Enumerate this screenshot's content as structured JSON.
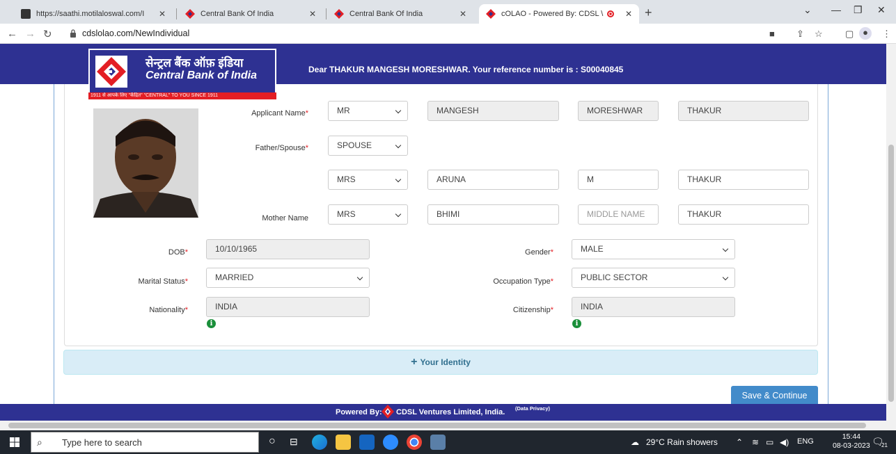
{
  "browser": {
    "tabs": [
      {
        "title": "https://saathi.motilaloswal.com/I"
      },
      {
        "title": "Central Bank Of India"
      },
      {
        "title": "Central Bank Of India"
      },
      {
        "title": "cOLAO - Powered By: CDSL \\"
      }
    ],
    "url": "cdslolao.com/NewIndividual"
  },
  "header": {
    "bank_hindi": "सेन्ट्रल बैंक ऑफ़ इंडिया",
    "bank_english": "Central Bank of India",
    "tagline": "1911 से आपके लिए ''केंद्रित''  \"CENTRAL\" TO YOU SINCE 1911",
    "greeting": "Dear THAKUR MANGESH MORESHWAR. Your reference number is : S00040845"
  },
  "form": {
    "applicant_label": "Applicant Name",
    "applicant_title": "MR",
    "applicant_first": "MANGESH",
    "applicant_middle": "MORESHWAR",
    "applicant_last": "THAKUR",
    "father_label": "Father/Spouse",
    "father_type": "SPOUSE",
    "spouse_title": "MRS",
    "spouse_first": "ARUNA",
    "spouse_middle": "M",
    "spouse_last": "THAKUR",
    "mother_label": "Mother Name",
    "mother_title": "MRS",
    "mother_first": "BHIMI",
    "mother_middle_placeholder": "MIDDLE NAME",
    "mother_last": "THAKUR",
    "dob_label": "DOB",
    "dob": "10/10/1965",
    "gender_label": "Gender",
    "gender": "MALE",
    "marital_label": "Marital Status",
    "marital": "MARRIED",
    "occupation_label": "Occupation Type",
    "occupation": "PUBLIC SECTOR",
    "nationality_label": "Nationality",
    "nationality": "INDIA",
    "citizenship_label": "Citizenship",
    "citizenship": "INDIA",
    "required_mark": "*"
  },
  "identity_section": "Your Identity",
  "save_button": "Save & Continue",
  "footer": {
    "powered_by": "Powered By:",
    "company": "CDSL Ventures Limited, India.",
    "privacy": "(Data Privacy)"
  },
  "taskbar": {
    "search_placeholder": "Type here to search",
    "weather": "29°C  Rain showers",
    "language": "ENG",
    "time": "15:44",
    "date": "08-03-2023",
    "notifications": "21"
  },
  "colors": {
    "header": "#2e3192",
    "accent_red": "#e31e24",
    "button": "#428bca"
  }
}
